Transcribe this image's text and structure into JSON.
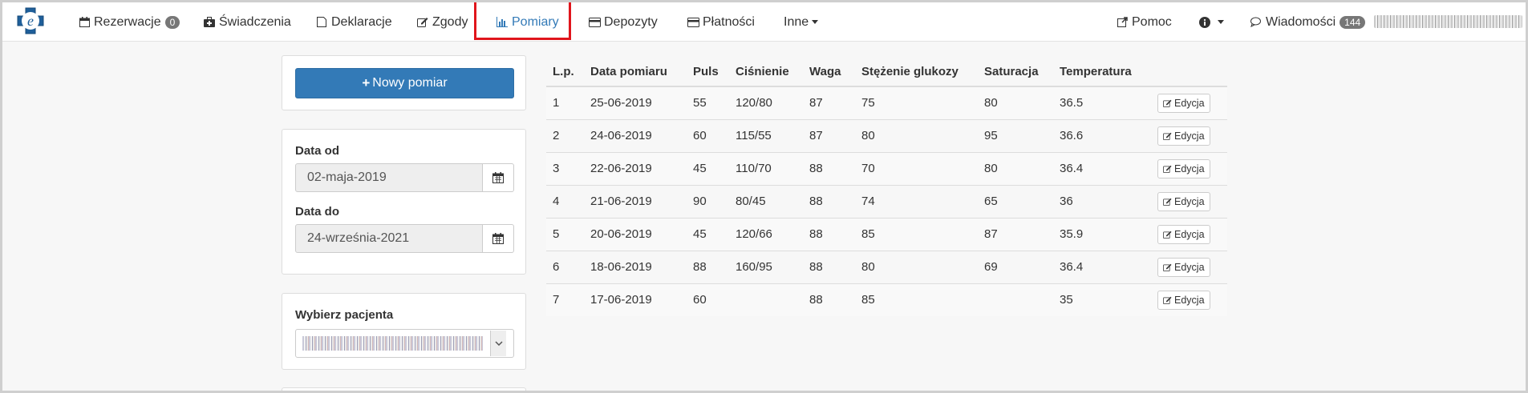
{
  "nav": {
    "items": [
      {
        "id": "rezerwacje",
        "label": "Rezerwacje",
        "icon": "calendar-icon",
        "badge": "0"
      },
      {
        "id": "swiadczenia",
        "label": "Świadczenia",
        "icon": "medkit-icon"
      },
      {
        "id": "deklaracje",
        "label": "Deklaracje",
        "icon": "document-icon"
      },
      {
        "id": "zgody",
        "label": "Zgody",
        "icon": "edit-icon"
      },
      {
        "id": "pomiary",
        "label": "Pomiary",
        "icon": "bar-chart-icon",
        "active": true
      },
      {
        "id": "depozyty",
        "label": "Depozyty",
        "icon": "credit-card-icon"
      },
      {
        "id": "platnosci",
        "label": "Płatności",
        "icon": "credit-card-icon"
      },
      {
        "id": "inne",
        "label": "Inne",
        "icon": "caret-down-icon"
      }
    ],
    "right": [
      {
        "id": "pomoc",
        "label": "Pomoc",
        "icon": "external-link-icon"
      },
      {
        "id": "info",
        "label": "",
        "icon": "info-icon"
      },
      {
        "id": "wiadomosci",
        "label": "Wiadomości",
        "icon": "comments-icon",
        "badge": "144"
      }
    ],
    "accent": "#337ab7",
    "highlight": "#e0151c"
  },
  "sidebar": {
    "new_button": "Nowy pomiar",
    "date_from_label": "Data od",
    "date_from_value": "02-maja-2019",
    "date_to_label": "Data do",
    "date_to_value": "24-września-2021",
    "patient_label": "Wybierz pacjenta"
  },
  "table": {
    "headers": [
      "L.p.",
      "Data pomiaru",
      "Puls",
      "Ciśnienie",
      "Waga",
      "Stężenie glukozy",
      "Saturacja",
      "Temperatura",
      ""
    ],
    "edit_label": "Edycja",
    "rows": [
      [
        "1",
        "25-06-2019",
        "55",
        "120/80",
        "87",
        "75",
        "80",
        "36.5"
      ],
      [
        "2",
        "24-06-2019",
        "60",
        "115/55",
        "87",
        "80",
        "95",
        "36.6"
      ],
      [
        "3",
        "22-06-2019",
        "45",
        "110/70",
        "88",
        "70",
        "80",
        "36.4"
      ],
      [
        "4",
        "21-06-2019",
        "90",
        "80/45",
        "88",
        "74",
        "65",
        "36"
      ],
      [
        "5",
        "20-06-2019",
        "45",
        "120/66",
        "88",
        "85",
        "87",
        "35.9"
      ],
      [
        "6",
        "18-06-2019",
        "88",
        "160/95",
        "88",
        "80",
        "69",
        "36.4"
      ],
      [
        "7",
        "17-06-2019",
        "60",
        "",
        "88",
        "85",
        "",
        "35"
      ]
    ]
  }
}
